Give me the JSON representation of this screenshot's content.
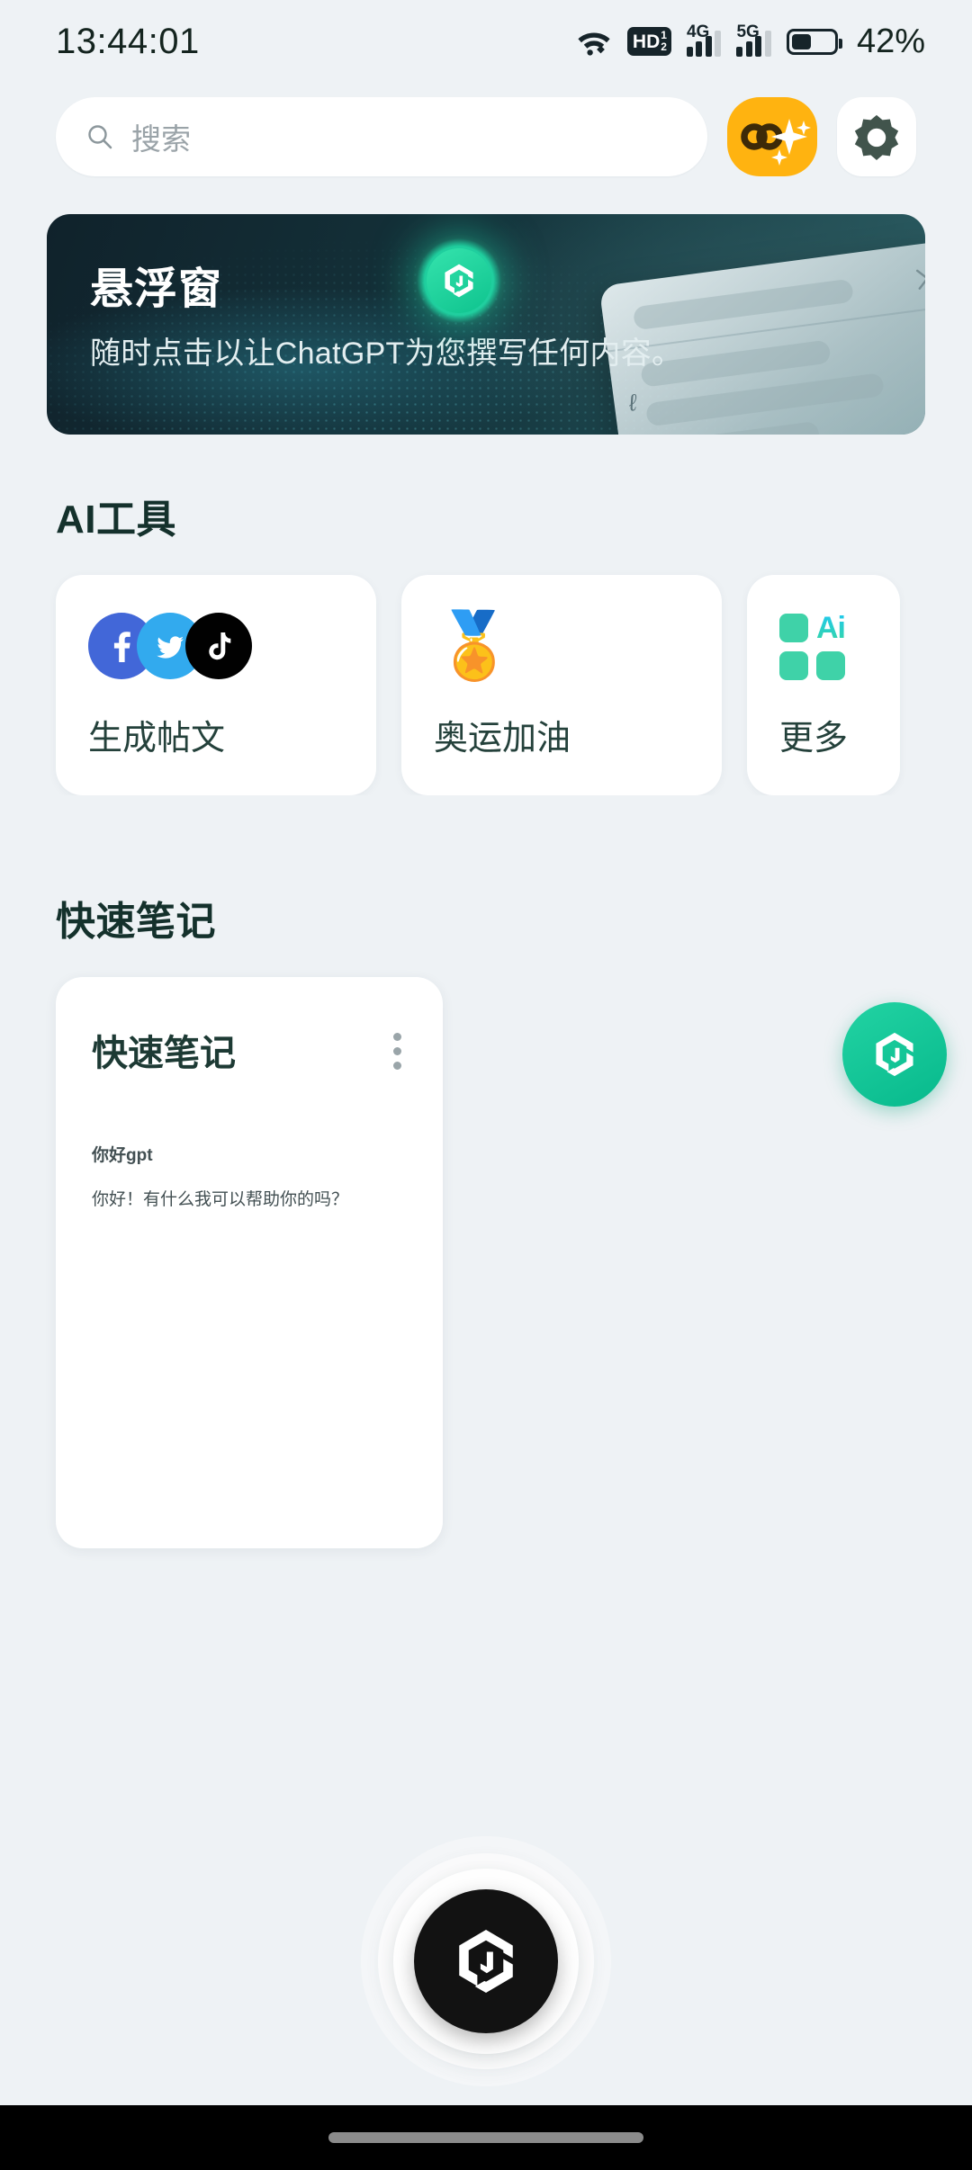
{
  "status_bar": {
    "time": "13:44:01",
    "wifi_icon": "wifi-icon",
    "hd_label": "HD",
    "hd_sup": "1",
    "hd_sub": "2",
    "signal_1_label": "4G",
    "signal_2_label": "5G",
    "battery_icon": "battery-icon",
    "battery_percent": "42%"
  },
  "search": {
    "placeholder": "搜索",
    "search_icon": "search-icon",
    "ai_button_icon": "ai-sparkle-icon",
    "settings_button_icon": "gear-icon"
  },
  "banner": {
    "title": "悬浮窗",
    "subtitle": "随时点击以让ChatGPT为您撰写任何内容。",
    "badge_icon": "app-logo-icon",
    "close_icon": "close-icon"
  },
  "ai_tools": {
    "heading": "AI工具",
    "cards": [
      {
        "label": "生成帖文",
        "icon": "social-stack-icon",
        "sub_icons": [
          "facebook-icon",
          "twitter-icon",
          "tiktok-icon"
        ]
      },
      {
        "label": "奥运加油",
        "icon": "medal-icon",
        "emoji": "🏅"
      },
      {
        "label": "更多",
        "icon": "grid-ai-icon",
        "ai_text": "Ai"
      }
    ]
  },
  "quick_notes": {
    "heading": "快速笔记",
    "note": {
      "title": "快速笔记",
      "menu_icon": "kebab-menu-icon",
      "lines": [
        "你好gpt",
        "你好！有什么我可以帮助你的吗？"
      ]
    }
  },
  "fab": {
    "icon": "app-logo-icon"
  },
  "home_orb": {
    "icon": "app-logo-icon"
  },
  "nav_bar": {
    "gesture_pill": "home-gesture-pill"
  },
  "colors": {
    "background": "#eef2f5",
    "accent_green": "#16c896",
    "accent_orange": "#ffb310",
    "text_dark": "#14312c",
    "banner_dark": "#14323a"
  }
}
